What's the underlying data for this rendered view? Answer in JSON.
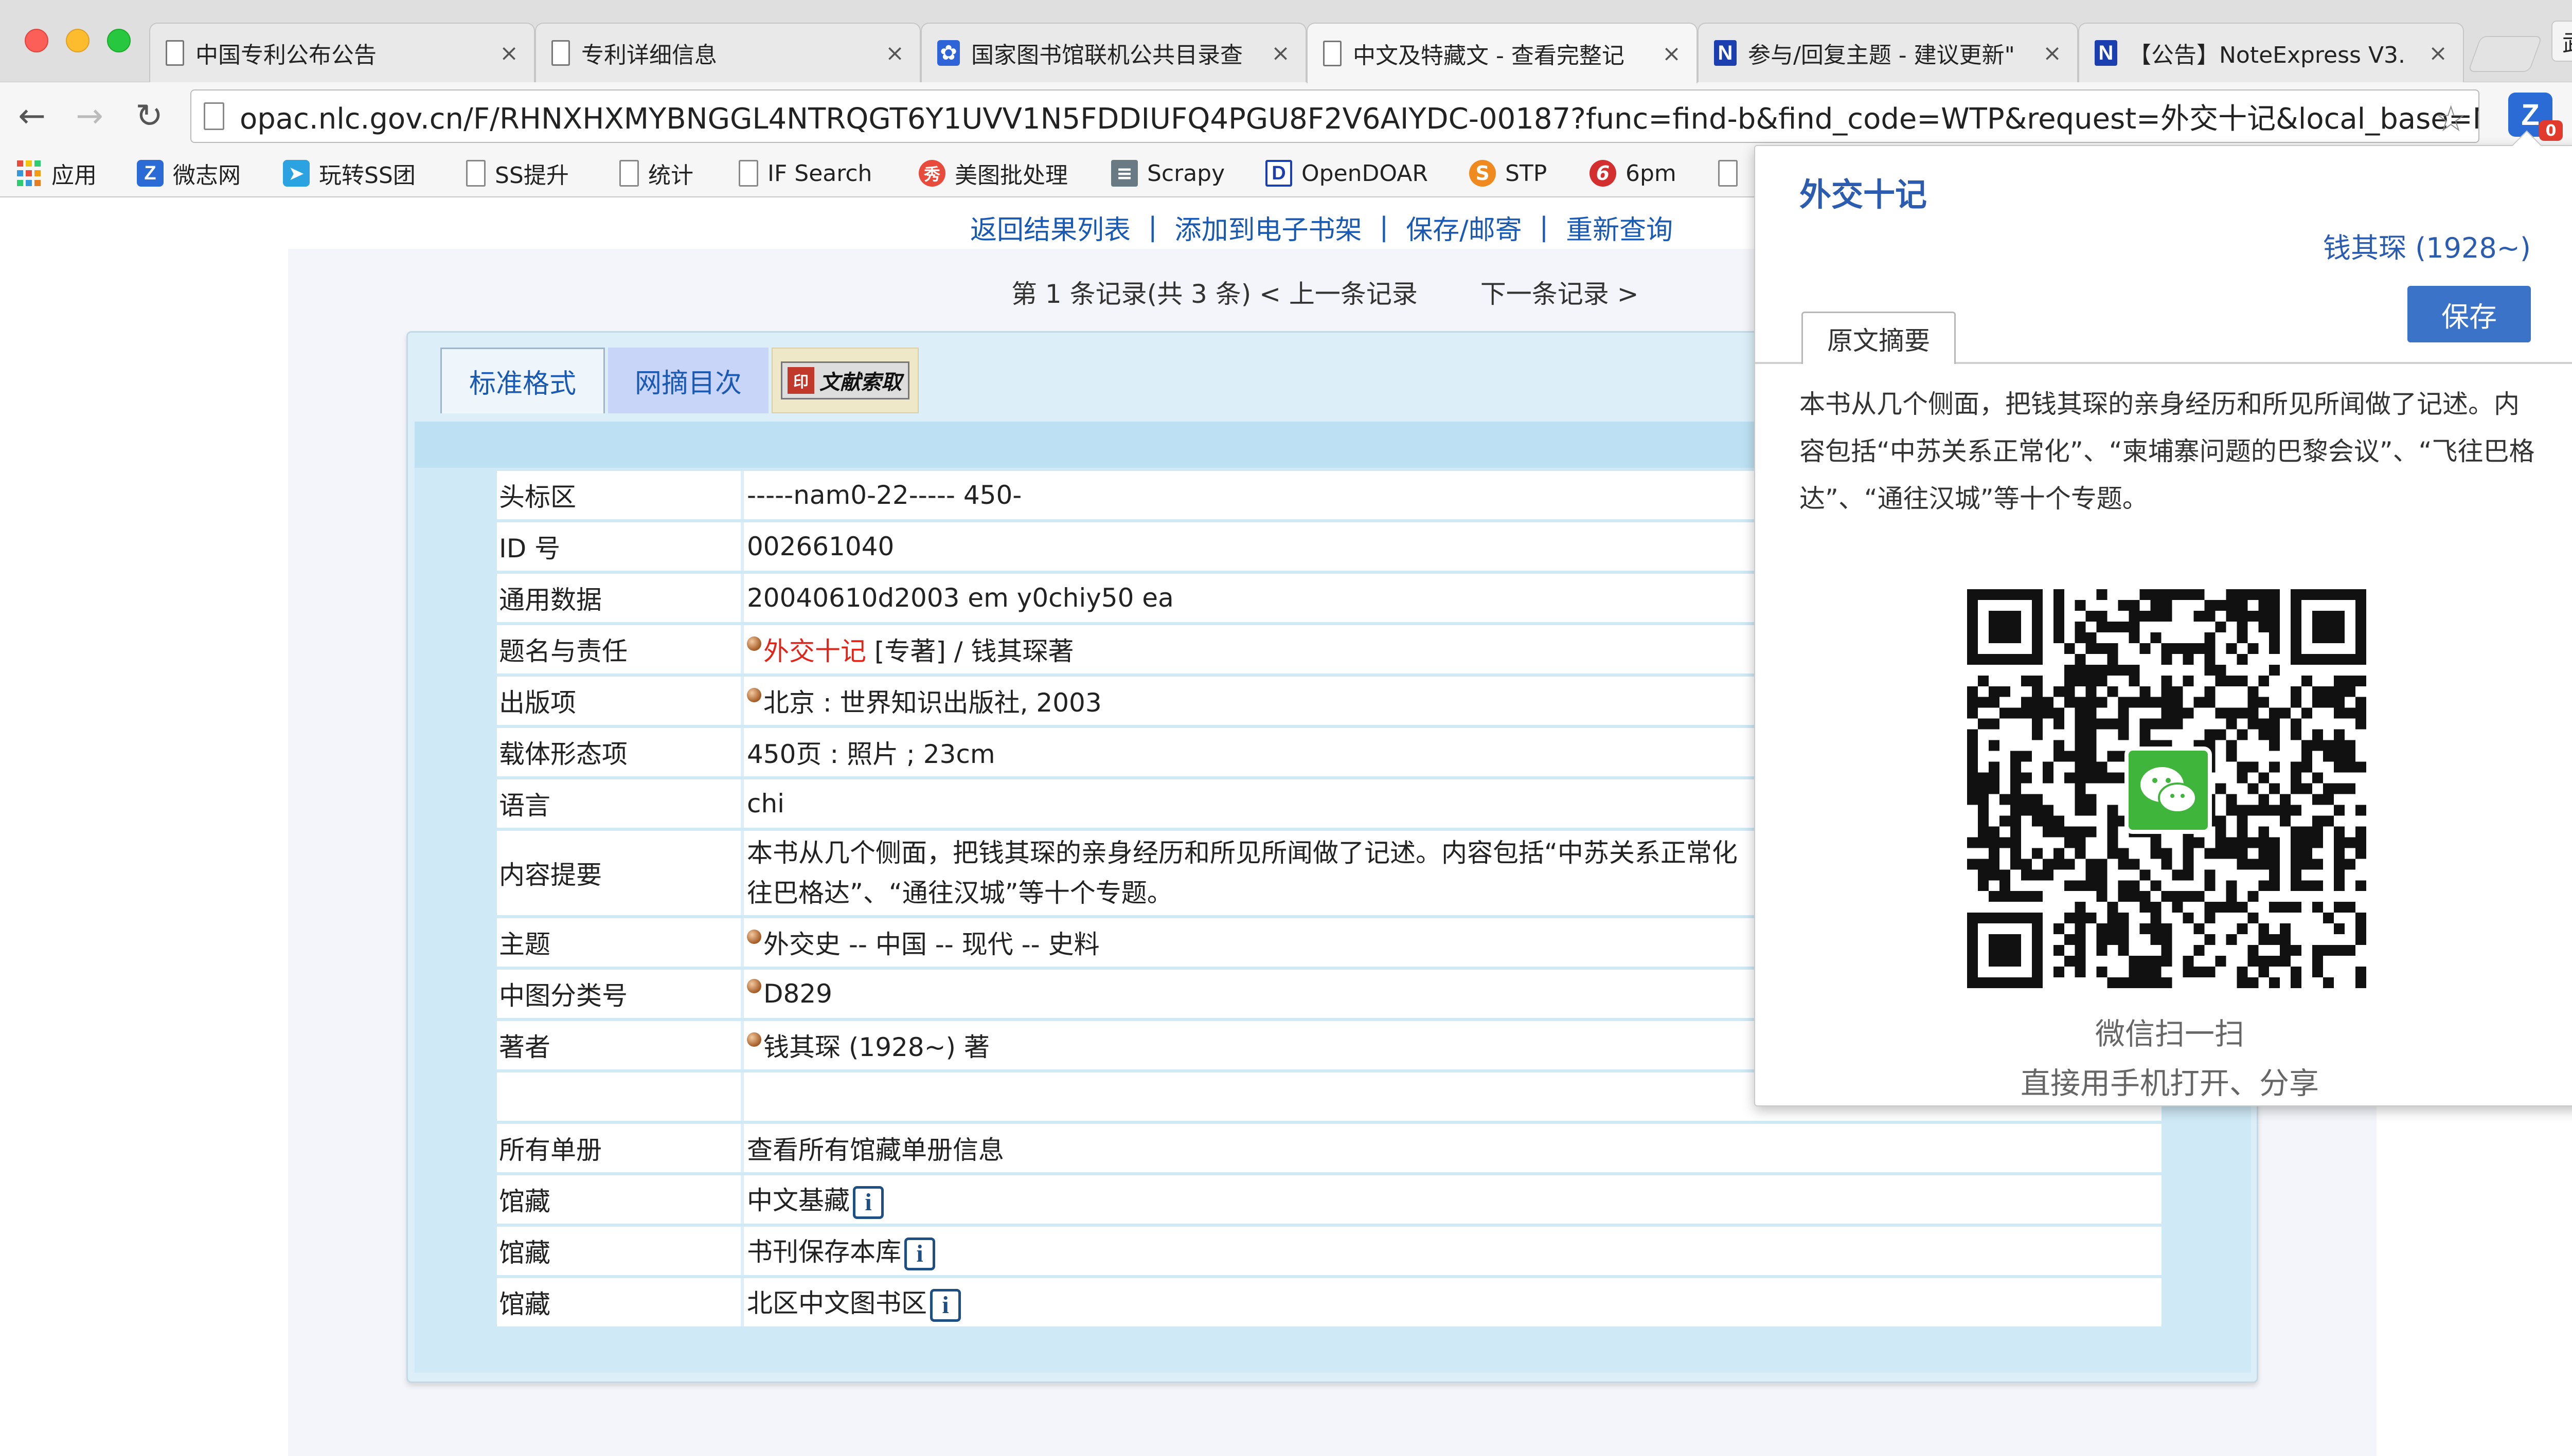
{
  "browser": {
    "tabs": [
      {
        "title": "中国专利公布公告",
        "favicon": "page-icon"
      },
      {
        "title": "专利详细信息",
        "favicon": "page-icon"
      },
      {
        "title": "国家图书馆联机公共目录查",
        "favicon": "baidu-paw-icon"
      },
      {
        "title": "中文及特藏文 - 查看完整记",
        "favicon": "page-icon",
        "active": true
      },
      {
        "title": "参与/回复主题 - 建议更新\"",
        "favicon": "noteexpress-icon"
      },
      {
        "title": "【公告】NoteExpress V3.",
        "favicon": "noteexpress-icon"
      }
    ],
    "close_glyph": "×",
    "profile_name": "武帅",
    "url": "opac.nlc.gov.cn/F/RHNXHXMYBNGGL4NTRQGT6Y1UVV1N5FDDIUFQ4PGU8F2V6AIYDC-00187?func=find-b&find_code=WTP&request=外交十记&local_base=NL...",
    "extension_badge": "0",
    "extension_letter": "Z",
    "bookmarks": [
      {
        "label": "应用",
        "icon": "apps-grid-icon"
      },
      {
        "label": "微志网",
        "icon": "z-icon"
      },
      {
        "label": "玩转SS团",
        "icon": "telegram-icon"
      },
      {
        "label": "SS提升",
        "icon": "page-icon"
      },
      {
        "label": "统计",
        "icon": "page-icon"
      },
      {
        "label": "IF Search",
        "icon": "page-icon"
      },
      {
        "label": "美图批处理",
        "icon": "meitu-icon"
      },
      {
        "label": "Scrapy",
        "icon": "scrapy-icon"
      },
      {
        "label": "OpenDOAR",
        "icon": "d-icon"
      },
      {
        "label": "STP",
        "icon": "stp-icon"
      },
      {
        "label": "6pm",
        "icon": "6pm-icon"
      }
    ]
  },
  "page": {
    "top_links": [
      "返回结果列表",
      "添加到电子书架",
      "保存/邮寄",
      "重新查询"
    ],
    "record_nav": {
      "position": "第 1 条记录(共 3 条)",
      "prev": "< 上一条记录",
      "next": "下一条记录 >"
    },
    "tabs": {
      "standard": "标准格式",
      "toc": "网摘目次",
      "doc_request": "文献索取"
    },
    "record": {
      "leader": {
        "key": "头标区",
        "value": "-----nam0-22----- 450-"
      },
      "id": {
        "key": "ID 号",
        "value": "002661040"
      },
      "general": {
        "key": "通用数据",
        "value": "20040610d2003 em y0chiy50 ea"
      },
      "title": {
        "key": "题名与责任",
        "title_link": "外交十记",
        "rest": " [专著] / 钱其琛著"
      },
      "publication": {
        "key": "出版项",
        "value": "北京 : 世界知识出版社, 2003"
      },
      "physical": {
        "key": "载体形态项",
        "value": "450页 : 照片 ; 23cm"
      },
      "language": {
        "key": "语言",
        "value": "chi"
      },
      "summary": {
        "key": "内容提要",
        "line1": "本书从几个侧面，把钱其琛的亲身经历和所见所闻做了记述。内容包括“中苏关系正常化",
        "line2": "往巴格达”、“通往汉城”等十个专题。"
      },
      "subject": {
        "key": "主题",
        "value": "外交史 -- 中国 -- 现代 -- 史料"
      },
      "classification": {
        "key": "中图分类号",
        "value": "D829"
      },
      "author": {
        "key": "著者",
        "value": "钱其琛 (1928~) 著"
      },
      "all_items": {
        "key": "所有单册",
        "value": "查看所有馆藏单册信息"
      },
      "holdings": [
        {
          "key": "馆藏",
          "value": "中文基藏"
        },
        {
          "key": "馆藏",
          "value": "书刊保存本库"
        },
        {
          "key": "馆藏",
          "value": "北区中文图书区"
        }
      ],
      "info_glyph": "i"
    }
  },
  "popup": {
    "title": "外交十记",
    "author": "钱其琛 (1928~)",
    "save_label": "保存",
    "abstract_tab": "原文摘要",
    "abstract_text": "本书从几个侧面，把钱其琛的亲身经历和所见所闻做了记述。内容包括“中苏关系正常化”、“柬埔寨问题的巴黎会议”、“飞往巴格达”、“通往汉城”等十个专题。",
    "scan_line1": "微信扫一扫",
    "scan_line2": "直接用手机打开、分享"
  },
  "colors": {
    "link_blue": "#1a5ab3",
    "title_red": "#e0261b",
    "card_bg": "#dceff9",
    "popup_accent": "#3b73c8",
    "wechat_green": "#3fb53b"
  }
}
